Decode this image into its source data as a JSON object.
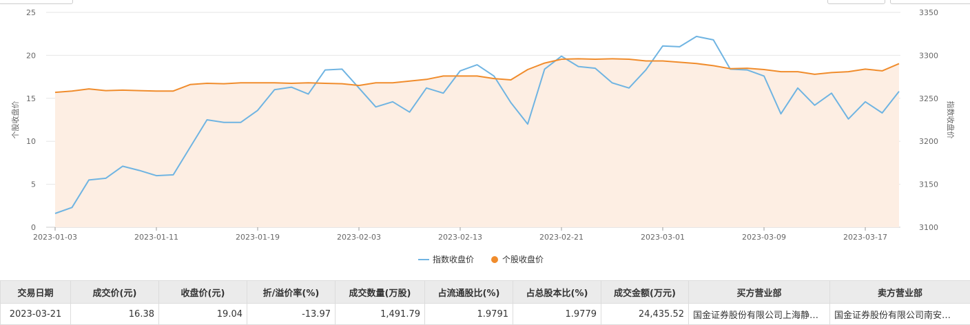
{
  "chart_data": {
    "type": "line",
    "x": [
      "2023-01-03",
      "2023-01-04",
      "2023-01-05",
      "2023-01-06",
      "2023-01-09",
      "2023-01-10",
      "2023-01-11",
      "2023-01-12",
      "2023-01-13",
      "2023-01-16",
      "2023-01-17",
      "2023-01-18",
      "2023-01-19",
      "2023-01-20",
      "2023-01-30",
      "2023-01-31",
      "2023-02-01",
      "2023-02-02",
      "2023-02-03",
      "2023-02-06",
      "2023-02-07",
      "2023-02-08",
      "2023-02-09",
      "2023-02-10",
      "2023-02-13",
      "2023-02-14",
      "2023-02-15",
      "2023-02-16",
      "2023-02-17",
      "2023-02-20",
      "2023-02-21",
      "2023-02-22",
      "2023-02-23",
      "2023-02-24",
      "2023-02-27",
      "2023-02-28",
      "2023-03-01",
      "2023-03-02",
      "2023-03-03",
      "2023-03-06",
      "2023-03-07",
      "2023-03-08",
      "2023-03-09",
      "2023-03-10",
      "2023-03-13",
      "2023-03-14",
      "2023-03-15",
      "2023-03-16",
      "2023-03-17",
      "2023-03-20",
      "2023-03-21"
    ],
    "x_ticks": [
      "2023-01-03",
      "2023-01-11",
      "2023-01-19",
      "2023-02-03",
      "2023-02-13",
      "2023-02-21",
      "2023-03-01",
      "2023-03-09",
      "2023-03-17"
    ],
    "series": [
      {
        "name": "指数收盘价",
        "axis": "right",
        "color": "#6fb4e2",
        "values": [
          3116,
          3123,
          3155,
          3157,
          3171,
          3166,
          3160,
          3161,
          3193,
          3225,
          3222,
          3222,
          3236,
          3260,
          3263,
          3255,
          3283,
          3284,
          3262,
          3240,
          3246,
          3234,
          3262,
          3256,
          3282,
          3289,
          3276,
          3245,
          3220,
          3284,
          3299,
          3287,
          3285,
          3268,
          3262,
          3283,
          3311,
          3310,
          3322,
          3318,
          3284,
          3283,
          3276,
          3232,
          3262,
          3242,
          3256,
          3226,
          3246,
          3233,
          3258
        ]
      },
      {
        "name": "个股收盘价",
        "axis": "left",
        "color": "#f08c2c",
        "values": [
          15.7,
          15.85,
          16.1,
          15.9,
          15.95,
          15.9,
          15.85,
          15.85,
          16.6,
          16.75,
          16.7,
          16.8,
          16.8,
          16.8,
          16.75,
          16.8,
          16.75,
          16.7,
          16.5,
          16.8,
          16.8,
          17.0,
          17.2,
          17.6,
          17.6,
          17.6,
          17.3,
          17.15,
          18.35,
          19.1,
          19.55,
          19.6,
          19.55,
          19.6,
          19.55,
          19.35,
          19.35,
          19.2,
          19.05,
          18.8,
          18.45,
          18.5,
          18.35,
          18.1,
          18.1,
          17.8,
          18.0,
          18.1,
          18.4,
          18.2,
          19.04
        ]
      }
    ],
    "y_left": {
      "label": "个股收盘价",
      "ylim": [
        0,
        25
      ],
      "ticks": [
        0,
        5,
        10,
        15,
        20,
        25
      ]
    },
    "y_right": {
      "label": "指数收盘价",
      "ylim": [
        3100,
        3350
      ],
      "ticks": [
        3100,
        3150,
        3200,
        3250,
        3300,
        3350
      ]
    },
    "grid": true,
    "legend_position": "bottom-center",
    "area_fill_color": "#fdeee3"
  },
  "table": {
    "headers": [
      "交易日期",
      "成交价(元)",
      "收盘价(元)",
      "折/溢价率(%)",
      "成交数量(万股)",
      "占流通股比(%)",
      "占总股本比(%)",
      "成交金额(万元)",
      "买方营业部",
      "卖方营业部"
    ],
    "rows": [
      [
        "2023-03-21",
        "16.38",
        "19.04",
        "-13.97",
        "1,491.79",
        "1.9791",
        "1.9779",
        "24,435.52",
        "国金证券股份有限公司上海静…",
        "国金证券股份有限公司南安…"
      ]
    ]
  }
}
